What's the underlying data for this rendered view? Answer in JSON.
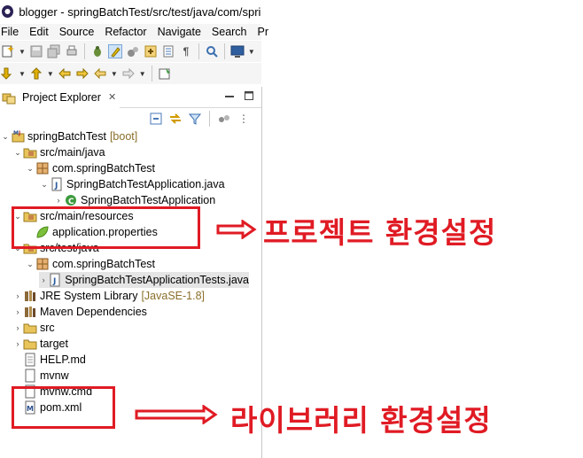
{
  "window": {
    "title": "blogger - springBatchTest/src/test/java/com/spring"
  },
  "menubar": {
    "items": [
      "File",
      "Edit",
      "Source",
      "Refactor",
      "Navigate",
      "Search",
      "Pr"
    ]
  },
  "view": {
    "title": "Project Explorer",
    "close_icon": "close-icon",
    "minimize_icon": "minimize-icon",
    "maximize_icon": "maximize-icon"
  },
  "tree": {
    "project": {
      "label": "springBatchTest",
      "decoration": "[boot]"
    },
    "src_main_java": "src/main/java",
    "pkg_main": "com.springBatchTest",
    "app_java": "SpringBatchTestApplication.java",
    "app_class": "SpringBatchTestApplication",
    "src_main_resources": "src/main/resources",
    "app_properties": "application.properties",
    "src_test_java": "src/test/java",
    "pkg_test": "com.springBatchTest",
    "app_tests_java": "SpringBatchTestApplicationTests.java",
    "jre": {
      "label": "JRE System Library",
      "decoration": "[JavaSE-1.8]"
    },
    "maven": "Maven Dependencies",
    "src": "src",
    "target": "target",
    "help": "HELP.md",
    "mvnw": "mvnw",
    "mvnw_cmd": "mvnw.cmd",
    "pom": "pom.xml"
  },
  "annotations": {
    "resources_note": "프로젝트 환경설정",
    "pom_note": "라이브러리 환경설정",
    "color": "#e01b24"
  }
}
